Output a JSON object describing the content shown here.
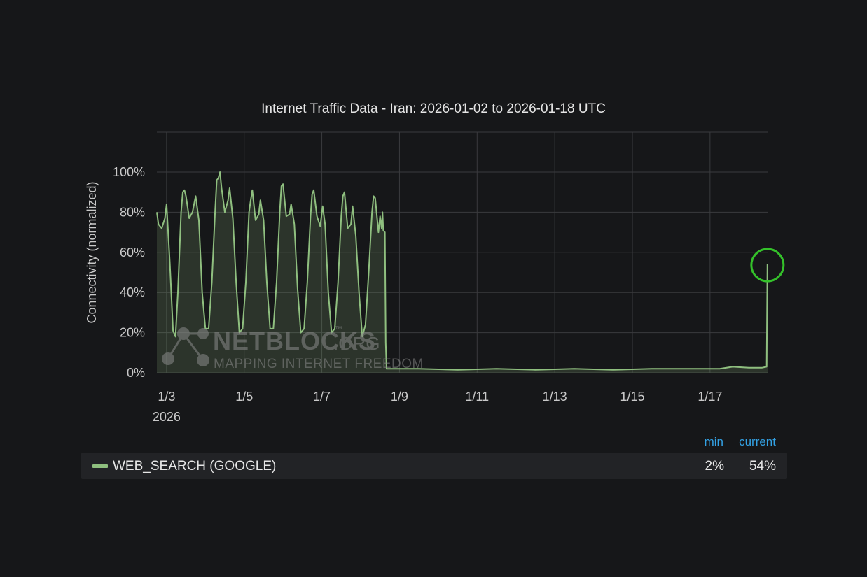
{
  "chart_data": {
    "type": "area",
    "title": "Internet Traffic Data - Iran: 2026-01-02 to 2026-01-18 UTC",
    "ylabel": "Connectivity (normalized)",
    "xlabel": "",
    "xlim": [
      "2026-01-02T18:00",
      "2026-01-18T12:00"
    ],
    "ylim": [
      0,
      100
    ],
    "y_ticks": [
      "0%",
      "20%",
      "40%",
      "60%",
      "80%",
      "100%"
    ],
    "x_ticks": [
      {
        "date": "2026-01-03",
        "label": "1/3",
        "sublabel": "2026"
      },
      {
        "date": "2026-01-05",
        "label": "1/5"
      },
      {
        "date": "2026-01-07",
        "label": "1/7"
      },
      {
        "date": "2026-01-09",
        "label": "1/9"
      },
      {
        "date": "2026-01-11",
        "label": "1/11"
      },
      {
        "date": "2026-01-13",
        "label": "1/13"
      },
      {
        "date": "2026-01-15",
        "label": "1/15"
      },
      {
        "date": "2026-01-17",
        "label": "1/17"
      }
    ],
    "grid": true,
    "legend_placement": "bottom",
    "series": [
      {
        "name": "WEB_SEARCH (GOOGLE)",
        "color": "#8fbf7f",
        "points": [
          [
            "2026-01-02T18:00",
            80
          ],
          [
            "2026-01-02T19:00",
            74
          ],
          [
            "2026-01-02T21:00",
            72
          ],
          [
            "2026-01-02T23:00",
            77
          ],
          [
            "2026-01-03T00:00",
            84
          ],
          [
            "2026-01-03T02:00",
            55
          ],
          [
            "2026-01-03T04:00",
            21
          ],
          [
            "2026-01-03T05:30",
            18
          ],
          [
            "2026-01-03T07:00",
            40
          ],
          [
            "2026-01-03T09:00",
            80
          ],
          [
            "2026-01-03T10:00",
            90
          ],
          [
            "2026-01-03T11:00",
            91
          ],
          [
            "2026-01-03T12:00",
            88
          ],
          [
            "2026-01-03T14:00",
            77
          ],
          [
            "2026-01-03T16:00",
            80
          ],
          [
            "2026-01-03T18:00",
            88
          ],
          [
            "2026-01-03T20:00",
            76
          ],
          [
            "2026-01-03T22:00",
            40
          ],
          [
            "2026-01-04T00:00",
            22
          ],
          [
            "2026-01-04T02:00",
            22
          ],
          [
            "2026-01-04T04:00",
            45
          ],
          [
            "2026-01-04T06:00",
            80
          ],
          [
            "2026-01-04T07:00",
            96
          ],
          [
            "2026-01-04T08:00",
            97
          ],
          [
            "2026-01-04T09:00",
            100
          ],
          [
            "2026-01-04T10:00",
            92
          ],
          [
            "2026-01-04T12:00",
            80
          ],
          [
            "2026-01-04T14:00",
            86
          ],
          [
            "2026-01-04T15:00",
            92
          ],
          [
            "2026-01-04T17:00",
            77
          ],
          [
            "2026-01-04T19:00",
            45
          ],
          [
            "2026-01-04T21:00",
            20
          ],
          [
            "2026-01-04T23:00",
            22
          ],
          [
            "2026-01-05T01:00",
            45
          ],
          [
            "2026-01-05T03:00",
            80
          ],
          [
            "2026-01-05T04:00",
            86
          ],
          [
            "2026-01-05T05:00",
            91
          ],
          [
            "2026-01-05T07:00",
            76
          ],
          [
            "2026-01-05T09:00",
            79
          ],
          [
            "2026-01-05T10:00",
            86
          ],
          [
            "2026-01-05T12:00",
            76
          ],
          [
            "2026-01-05T14:00",
            45
          ],
          [
            "2026-01-05T16:00",
            22
          ],
          [
            "2026-01-05T18:00",
            22
          ],
          [
            "2026-01-05T20:00",
            45
          ],
          [
            "2026-01-05T22:00",
            80
          ],
          [
            "2026-01-05T23:00",
            93
          ],
          [
            "2026-01-06T00:00",
            94
          ],
          [
            "2026-01-06T02:00",
            78
          ],
          [
            "2026-01-06T04:00",
            79
          ],
          [
            "2026-01-06T05:00",
            84
          ],
          [
            "2026-01-06T07:00",
            74
          ],
          [
            "2026-01-06T09:00",
            42
          ],
          [
            "2026-01-06T11:00",
            20
          ],
          [
            "2026-01-06T13:00",
            22
          ],
          [
            "2026-01-06T15:00",
            45
          ],
          [
            "2026-01-06T17:00",
            78
          ],
          [
            "2026-01-06T18:00",
            89
          ],
          [
            "2026-01-06T19:00",
            91
          ],
          [
            "2026-01-06T21:00",
            78
          ],
          [
            "2026-01-06T23:00",
            73
          ],
          [
            "2026-01-07T00:30",
            83
          ],
          [
            "2026-01-07T02:00",
            74
          ],
          [
            "2026-01-07T04:00",
            40
          ],
          [
            "2026-01-07T06:00",
            20
          ],
          [
            "2026-01-07T08:00",
            22
          ],
          [
            "2026-01-07T10:00",
            45
          ],
          [
            "2026-01-07T12:00",
            78
          ],
          [
            "2026-01-07T13:00",
            88
          ],
          [
            "2026-01-07T14:00",
            90
          ],
          [
            "2026-01-07T16:00",
            72
          ],
          [
            "2026-01-07T18:00",
            74
          ],
          [
            "2026-01-07T19:00",
            83
          ],
          [
            "2026-01-07T21:00",
            68
          ],
          [
            "2026-01-07T23:00",
            40
          ],
          [
            "2026-01-08T01:00",
            18
          ],
          [
            "2026-01-08T03:00",
            24
          ],
          [
            "2026-01-08T05:00",
            50
          ],
          [
            "2026-01-08T07:00",
            80
          ],
          [
            "2026-01-08T08:00",
            88
          ],
          [
            "2026-01-08T09:00",
            87
          ],
          [
            "2026-01-08T11:00",
            70
          ],
          [
            "2026-01-08T12:00",
            78
          ],
          [
            "2026-01-08T13:00",
            72
          ],
          [
            "2026-01-08T13:30",
            80
          ],
          [
            "2026-01-08T14:00",
            71
          ],
          [
            "2026-01-08T15:00",
            70
          ],
          [
            "2026-01-08T15:30",
            15
          ],
          [
            "2026-01-08T16:00",
            2
          ],
          [
            "2026-01-09T12:00",
            2
          ],
          [
            "2026-01-10T12:00",
            1.5
          ],
          [
            "2026-01-11T12:00",
            2
          ],
          [
            "2026-01-12T12:00",
            1.5
          ],
          [
            "2026-01-13T12:00",
            2
          ],
          [
            "2026-01-14T12:00",
            1.5
          ],
          [
            "2026-01-15T12:00",
            2
          ],
          [
            "2026-01-16T12:00",
            2
          ],
          [
            "2026-01-17T06:00",
            2
          ],
          [
            "2026-01-17T14:00",
            3
          ],
          [
            "2026-01-18T00:00",
            2.5
          ],
          [
            "2026-01-18T08:00",
            2.5
          ],
          [
            "2026-01-18T11:00",
            3
          ],
          [
            "2026-01-18T11:30",
            54
          ],
          [
            "2026-01-18T12:00",
            54
          ]
        ]
      }
    ],
    "annotation": {
      "type": "circle",
      "date": "2026-01-18T11:30",
      "value": 54,
      "color": "#34c12a"
    }
  },
  "watermark": {
    "brand": "NETBLOCKS",
    "tld": ".ORG",
    "tm": "™",
    "tagline": "MAPPING INTERNET FREEDOM"
  },
  "legend": {
    "header_min": "min",
    "header_current": "current",
    "series_name": "WEB_SEARCH (GOOGLE)",
    "min": "2%",
    "current": "54%",
    "swatch_color": "#8fbf7f",
    "header_color": "#33a2e5"
  }
}
